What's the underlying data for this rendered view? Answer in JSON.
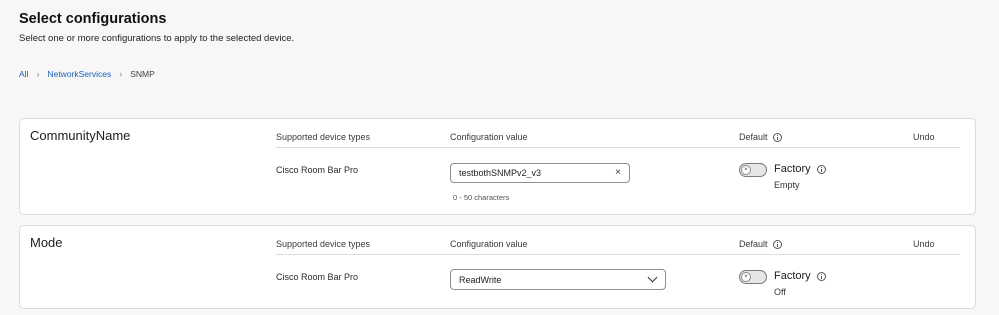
{
  "header": {
    "title": "Select configurations",
    "subtitle": "Select one or more configurations to apply to the selected device."
  },
  "breadcrumb": {
    "items": [
      "All",
      "NetworkServices",
      "SNMP"
    ],
    "separator": "›"
  },
  "columns": {
    "supported_types": "Supported device types",
    "config_value": "Configuration value",
    "default": "Default",
    "undo": "Undo"
  },
  "cards": [
    {
      "title": "CommunityName",
      "device_type": "Cisco Room Bar Pro",
      "input_value": "testbothSNMPv2_v3",
      "helper": "0 - 50 characters",
      "clear_icon": "×",
      "default_label": "Factory",
      "default_value": "Empty",
      "toggle_on": false
    },
    {
      "title": "Mode",
      "device_type": "Cisco Room Bar Pro",
      "select_value": "ReadWrite",
      "default_label": "Factory",
      "default_value": "Off",
      "toggle_on": false
    }
  ],
  "toggle_knob_glyph": "×",
  "icons": {
    "info": "info-icon",
    "clear": "close-icon",
    "dropdown": "chevron-down-icon"
  },
  "colors": {
    "link": "#1a5fb4",
    "background": "#f7f7f7",
    "card": "#ffffff"
  }
}
